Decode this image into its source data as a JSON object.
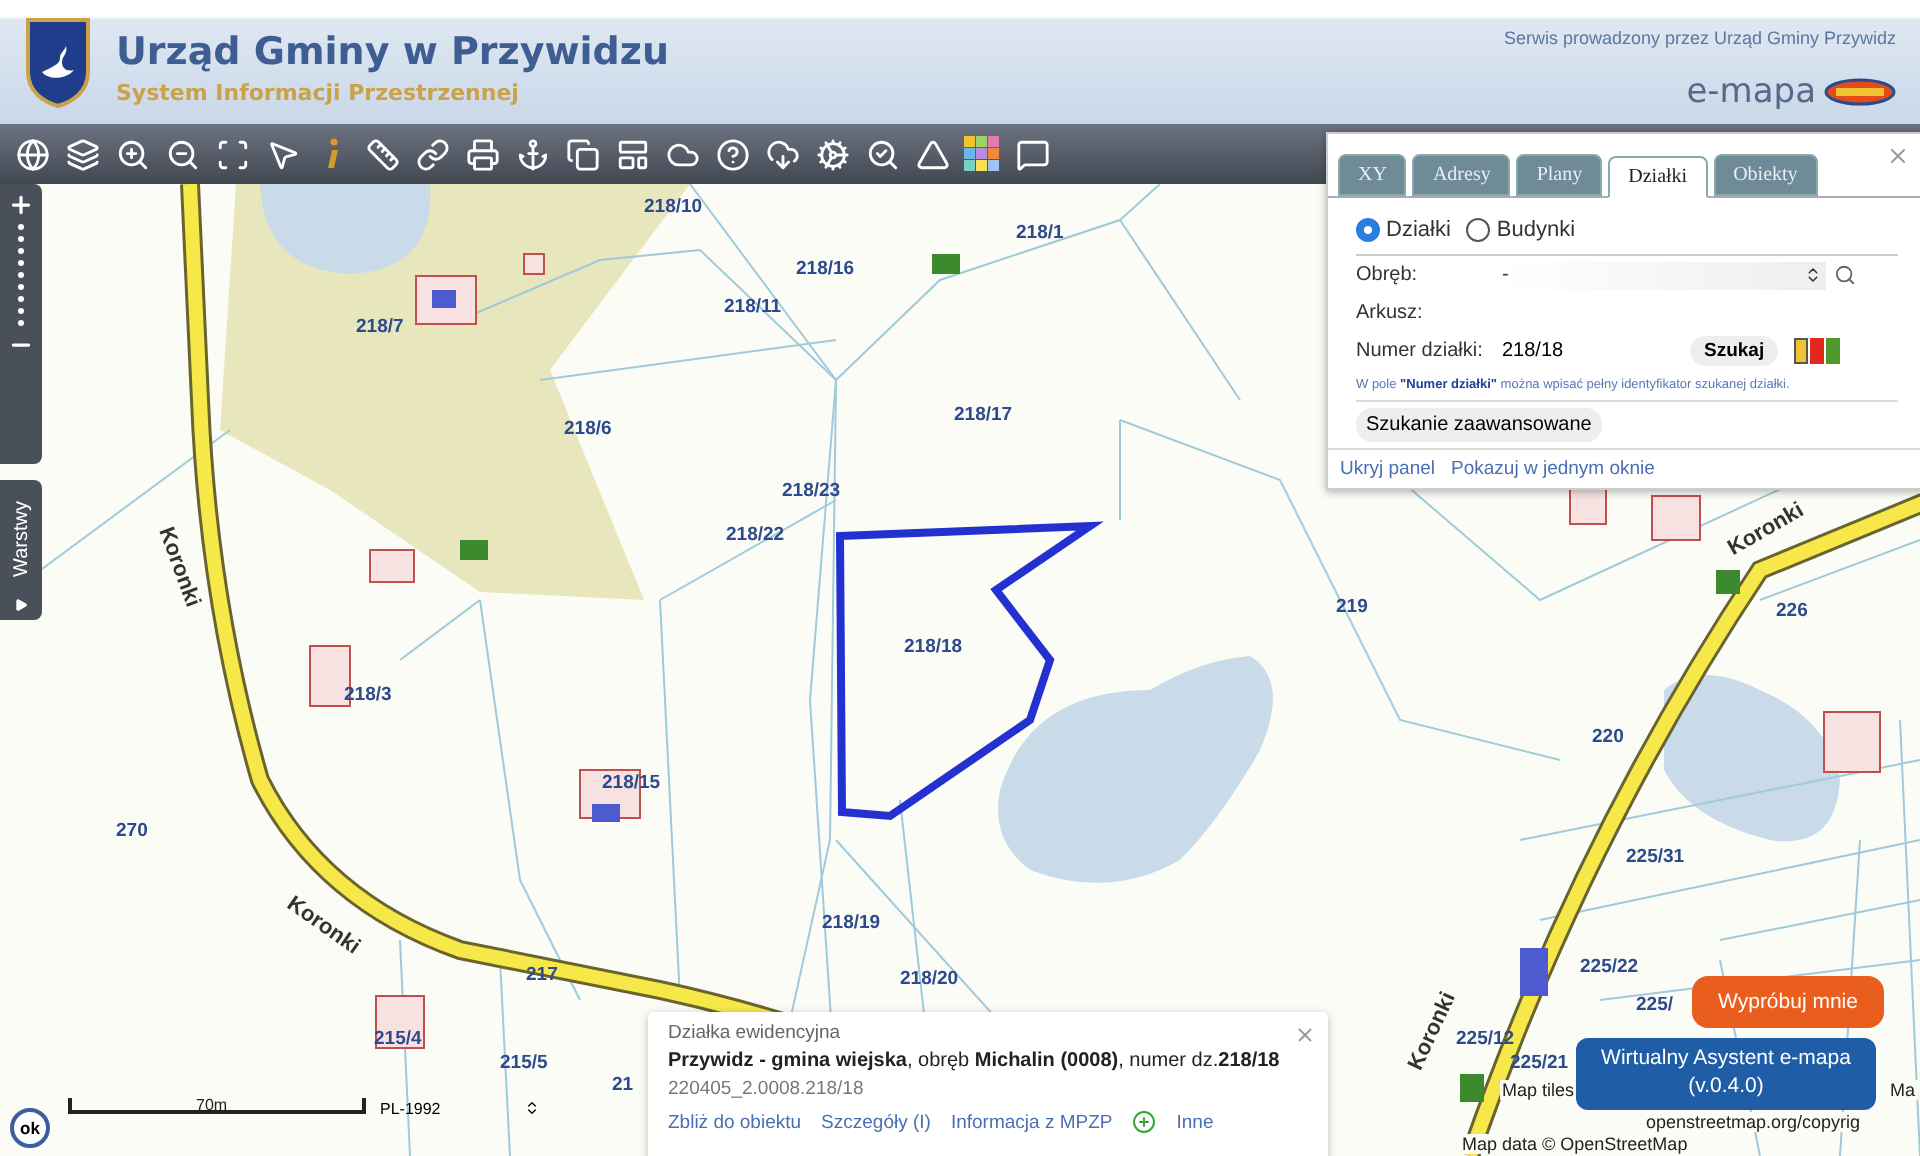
{
  "header": {
    "title": "Urząd Gminy w Przywidzu",
    "subtitle": "System Informacji Przestrzennej",
    "service_note": "Serwis prowadzony przez Urząd Gminy Przywidz",
    "brand": "e-mapa"
  },
  "sidebar": {
    "layers_tab": "Warstwy"
  },
  "map_labels": [
    {
      "text": "218/10",
      "kind": "parcel"
    },
    {
      "text": "218/1",
      "kind": "parcel"
    },
    {
      "text": "218/16",
      "kind": "parcel"
    },
    {
      "text": "218/11",
      "kind": "parcel"
    },
    {
      "text": "218/7",
      "kind": "parcel"
    },
    {
      "text": "218/6",
      "kind": "parcel"
    },
    {
      "text": "218/17",
      "kind": "parcel"
    },
    {
      "text": "218/23",
      "kind": "parcel"
    },
    {
      "text": "218/22",
      "kind": "parcel"
    },
    {
      "text": "218/18",
      "kind": "parcel"
    },
    {
      "text": "219",
      "kind": "parcel"
    },
    {
      "text": "226",
      "kind": "parcel"
    },
    {
      "text": "220",
      "kind": "parcel"
    },
    {
      "text": "218/3",
      "kind": "parcel"
    },
    {
      "text": "218/15",
      "kind": "parcel"
    },
    {
      "text": "270",
      "kind": "parcel"
    },
    {
      "text": "225/31",
      "kind": "parcel"
    },
    {
      "text": "225/22",
      "kind": "parcel"
    },
    {
      "text": "225/",
      "kind": "parcel"
    },
    {
      "text": "225/12",
      "kind": "parcel"
    },
    {
      "text": "225/21",
      "kind": "parcel"
    },
    {
      "text": "218/19",
      "kind": "parcel"
    },
    {
      "text": "218/20",
      "kind": "parcel"
    },
    {
      "text": "217",
      "kind": "parcel"
    },
    {
      "text": "215/4",
      "kind": "parcel"
    },
    {
      "text": "215/5",
      "kind": "parcel"
    },
    {
      "text": "21",
      "kind": "parcel"
    },
    {
      "text": "Koronki",
      "kind": "street"
    },
    {
      "text": "Koronki",
      "kind": "street"
    },
    {
      "text": "Koronki",
      "kind": "street"
    },
    {
      "text": "Koronki",
      "kind": "street"
    },
    {
      "text": "Map tiles",
      "kind": "credit"
    },
    {
      "text": "Ma",
      "kind": "credit"
    },
    {
      "text": "Map data © OpenStreetMap",
      "kind": "credit"
    },
    {
      "text": "openstreetmap.org/copyrig",
      "kind": "credit"
    }
  ],
  "search_panel": {
    "tabs": [
      {
        "label": "XY",
        "selected": false
      },
      {
        "label": "Adresy",
        "selected": false
      },
      {
        "label": "Plany",
        "selected": false
      },
      {
        "label": "Działki",
        "selected": true
      },
      {
        "label": "Obiekty",
        "selected": false
      }
    ],
    "object_types": [
      {
        "label": "Działki",
        "selected": true
      },
      {
        "label": "Budynki",
        "selected": false
      }
    ],
    "fields": [
      {
        "label": "Obręb:",
        "kind": "select",
        "value": "-"
      },
      {
        "label": "Arkusz:",
        "kind": "text"
      },
      {
        "label": "Numer działki:",
        "kind": "input",
        "value": "218/18"
      }
    ],
    "search_button": "Szukaj",
    "highlight_colors": [
      {
        "color": "#f2c230",
        "selected": true
      },
      {
        "color": "#e2281e",
        "selected": false
      },
      {
        "color": "#4f9a2c",
        "selected": false
      }
    ],
    "hint": "W pole **\"Numer działki\"** można wpisać pełny identyfikator szukanej działki.",
    "advanced_button": "Szukanie zaawansowane",
    "links": [
      "Ukryj panel",
      "Pokazuj w jednym oknie"
    ]
  },
  "parcel_popup": {
    "title": "Działka ewidencyjna",
    "description": "**Przywidz - gmina wiejska**, obręb **Michalin (0008)**, numer dz.**218/18**",
    "identifier": "220405_2.0008.218/18",
    "links": [
      {
        "label": "Zbliż do obiektu",
        "kind": "link"
      },
      {
        "label": "Szczegóły (I)",
        "kind": "link"
      },
      {
        "label": "Informacja z MPZP",
        "kind": "link"
      },
      {
        "label": "Inne",
        "kind": "plus-link"
      }
    ]
  },
  "scale": {
    "distance": "70m",
    "projection": "PL-1992"
  },
  "ok_button": "ok",
  "assistant": {
    "bubble": "Wypróbuj mnie",
    "button": "Wirtualny Asystent e-mapa\n(v.0.4.0)"
  }
}
